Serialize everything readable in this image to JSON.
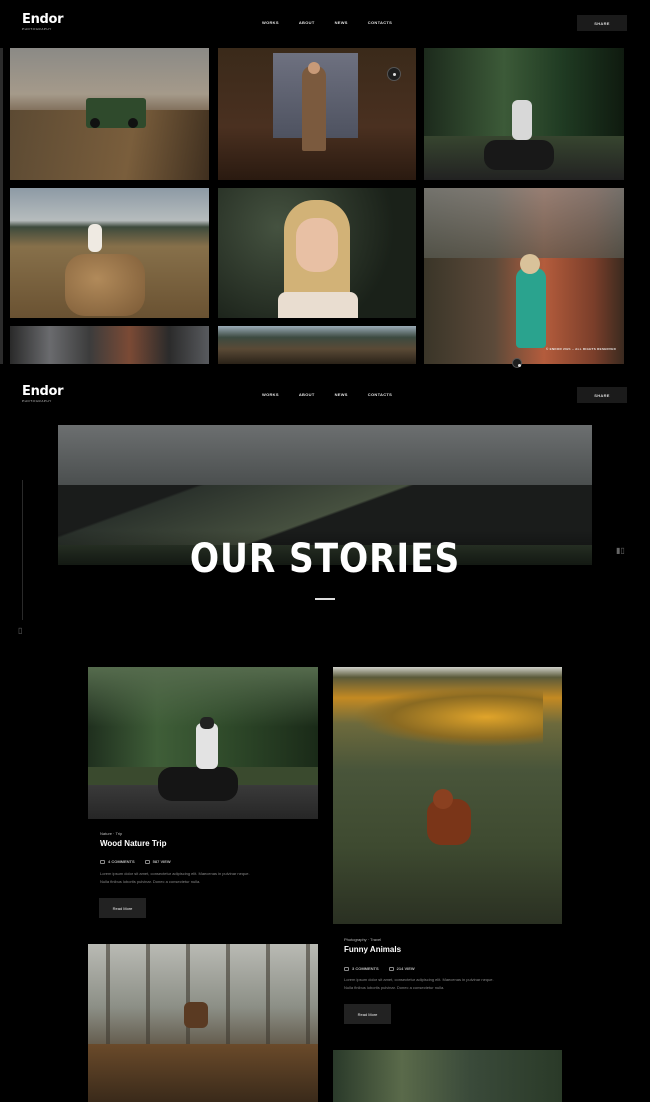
{
  "brand": {
    "name": "Endor",
    "tagline": "PHOTOGRAPHY"
  },
  "nav": [
    "WORKS",
    "ABOUT",
    "NEWS",
    "CONTACTS"
  ],
  "share_label": "SHARE",
  "gallery": {
    "copyright": "© ENDOR 2021 – ALL RIGHTS RESERVED",
    "tiles": [
      "truck-on-hill-photo",
      "woman-backdrop-photo",
      "motorcycle-forest-photo",
      "hay-bale-photo",
      "blonde-portrait-photo",
      "woman-cliff-photo",
      "interior-strip-photo",
      "landscape-strip-photo"
    ]
  },
  "hero": {
    "title": "OUR STORIES"
  },
  "posts": [
    {
      "category": "Nature · Trip",
      "title": "Wood Nature Trip",
      "comments": "4 COMMENTS",
      "views": "587 VIEW",
      "excerpt_1": "Lorem ipsum dolor sit amet, consectetur adipiscing elit. Maecenas in pulvinar neque.",
      "excerpt_2": "Nulla finibus lobortis pulvinar. Donec a consectetur nulla.",
      "read_more": "Read More"
    },
    {
      "category": "Photography · Travel",
      "title": "Funny Animals",
      "comments": "3 COMMENTS",
      "views": "214 VIEW",
      "excerpt_1": "Lorem ipsum dolor sit amet, consectetur adipiscing elit. Maecenas in pulvinar neque.",
      "excerpt_2": "Nulla finibus lobortis pulvinar. Donec a consectetur nulla.",
      "read_more": "Read More"
    }
  ],
  "colors": {
    "background": "#000000",
    "button": "#1b1b1b"
  }
}
